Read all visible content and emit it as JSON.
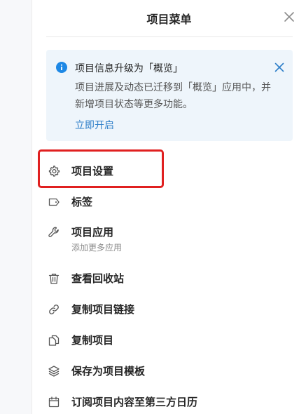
{
  "panel": {
    "title": "项目菜单"
  },
  "notice": {
    "title": "项目信息升级为「概览」",
    "body": "项目进展及动态已迁移到「概览」应用中，并新增项目状态等更多功能。",
    "link": "立即开启"
  },
  "menu": {
    "items": [
      {
        "label": "项目设置",
        "icon": "gear-icon"
      },
      {
        "label": "标签",
        "icon": "tag-icon"
      },
      {
        "label": "项目应用",
        "sub": "添加更多应用",
        "icon": "wrench-icon"
      },
      {
        "label": "查看回收站",
        "icon": "trash-icon"
      },
      {
        "label": "复制项目链接",
        "icon": "link-icon"
      },
      {
        "label": "复制项目",
        "icon": "copy-icon"
      },
      {
        "label": "保存为项目模板",
        "icon": "layers-icon"
      },
      {
        "label": "订阅项目内容至第三方日历",
        "icon": "calendar-icon"
      }
    ]
  },
  "colors": {
    "accent": "#2f7fc9",
    "highlight": "#e02020",
    "notice_bg": "#eef5fb"
  }
}
